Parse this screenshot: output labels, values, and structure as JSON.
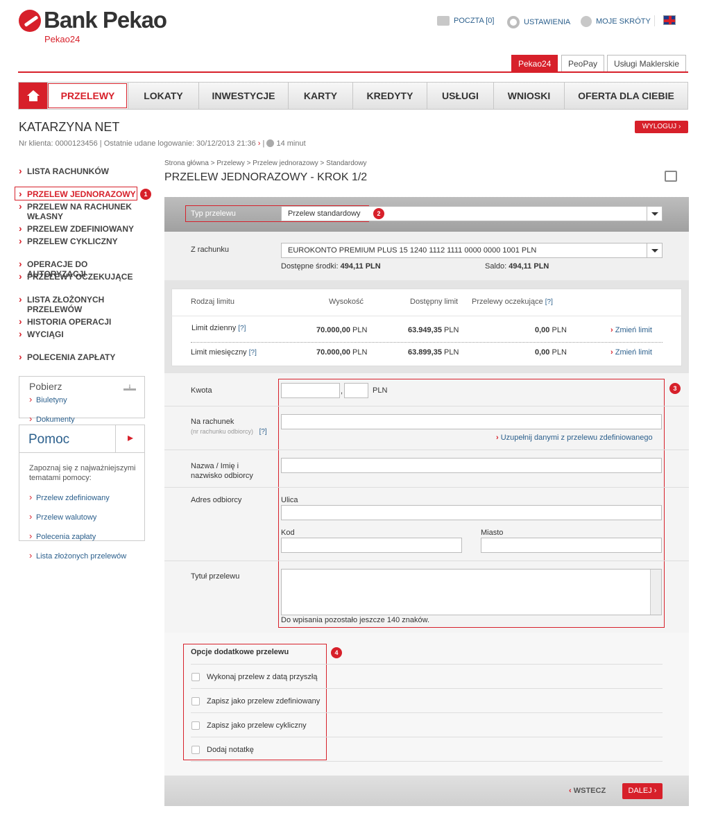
{
  "brand": {
    "name": "Bank Pekao",
    "sub": "Pekao24"
  },
  "toplinks": {
    "mail": "POCZTA [0]",
    "settings": "USTAWIENIA",
    "shortcuts": "MOJE SKRÓTY"
  },
  "product_tabs": [
    "Pekao24",
    "PeoPay",
    "Usługi Maklerskie"
  ],
  "nav": {
    "items": [
      "PRZELEWY",
      "LOKATY",
      "INWESTYCJE",
      "KARTY",
      "KREDYTY",
      "USŁUGI",
      "WNIOSKI",
      "OFERTA DLA CIEBIE"
    ]
  },
  "user": {
    "name": "KATARZYNA NET",
    "client_label": "Nr klienta: 0000123456",
    "last_login": "Ostatnie udane logowanie: 30/12/2013 21:36",
    "session": "14 minut",
    "logout": "WYLOGUJ"
  },
  "sidebar": {
    "items": [
      "LISTA RACHUNKÓW",
      "PRZELEW JEDNORAZOWY",
      "PRZELEW NA RACHUNEK WŁASNY",
      "PRZELEW ZDEFINIOWANY",
      "PRZELEW CYKLICZNY",
      "OPERACJE DO AUTORYZACJI",
      "PRZELEWY OCZEKUJĄCE",
      "LISTA ZŁOŻONYCH PRZELEWÓW",
      "HISTORIA OPERACJI",
      "WYCIĄGI",
      "POLECENIA ZAPŁATY"
    ]
  },
  "download": {
    "title": "Pobierz",
    "links": [
      "Biuletyny",
      "Dokumenty"
    ]
  },
  "help": {
    "title": "Pomoc",
    "text": "Zapoznaj się z najważniejszymi tematami pomocy:",
    "links": [
      "Przelew zdefiniowany",
      "Przelew walutowy",
      "Polecenia zapłaty",
      "Lista złożonych przelewów"
    ]
  },
  "breadcrumb": "Strona główna > Przelewy > Przelew jednorazowy > Standardowy",
  "page_title": "PRZELEW JEDNORAZOWY - KROK 1/2",
  "transfer_type": {
    "label": "Typ przelewu",
    "value": "Przelew standardowy"
  },
  "account": {
    "label": "Z rachunku",
    "value": "EUROKONTO PREMIUM PLUS 15 1240 1112 1111 0000 0000 1001 PLN",
    "available_label": "Dostępne środki:",
    "available": "494,11 PLN",
    "balance_label": "Saldo:",
    "balance": "494,11 PLN"
  },
  "limits": {
    "headers": [
      "Rodzaj limitu",
      "Wysokość",
      "Dostępny limit",
      "Przelewy oczekujące"
    ],
    "rows": [
      {
        "name": "Limit dzienny",
        "amount": "70.000,00",
        "available": "63.949,35",
        "pending": "0,00",
        "action": "Zmień limit"
      },
      {
        "name": "Limit miesięczny",
        "amount": "70.000,00",
        "available": "63.899,35",
        "pending": "0,00",
        "action": "Zmień limit"
      }
    ],
    "currency": "PLN",
    "help": "[?]"
  },
  "form": {
    "amount_label": "Kwota",
    "currency": "PLN",
    "account_label": "Na rachunek",
    "account_hint": "(nr rachunku odbiorcy)",
    "fill_link": "Uzupełnij danymi z przelewu zdefiniowanego",
    "name_label": "Nazwa / Imię i nazwisko odbiorcy",
    "address_label": "Adres odbiorcy",
    "street": "Ulica",
    "code": "Kod",
    "city": "Miasto",
    "title_label": "Tytuł przelewu",
    "remaining": "Do wpisania pozostało jeszcze 140 znaków."
  },
  "options": {
    "title": "Opcje dodatkowe przelewu",
    "items": [
      "Wykonaj przelew z datą przyszłą",
      "Zapisz jako przelew zdefiniowany",
      "Zapisz jako przelew cykliczny",
      "Dodaj notatkę"
    ]
  },
  "buttons": {
    "back": "WSTECZ",
    "next": "DALEJ"
  },
  "badges": [
    "1",
    "2",
    "3",
    "4"
  ]
}
